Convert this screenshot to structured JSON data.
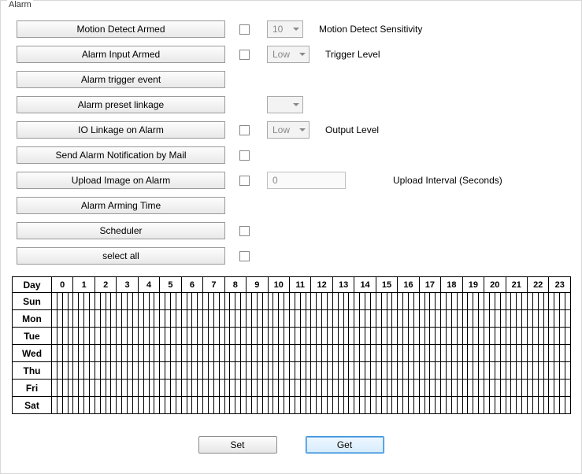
{
  "group_title": "Alarm",
  "rows": {
    "motion_detect_armed": "Motion Detect Armed",
    "alarm_input_armed": "Alarm Input Armed",
    "alarm_trigger_event": "Alarm trigger event",
    "alarm_preset_linkage": "Alarm preset linkage",
    "io_linkage_on_alarm": "IO Linkage on Alarm",
    "send_alarm_mail": "Send Alarm Notification by Mail",
    "upload_image_on_alarm": "Upload Image on Alarm",
    "alarm_arming_time": "Alarm Arming Time",
    "scheduler": "Scheduler",
    "select_all": "select all"
  },
  "selects": {
    "motion_sensitivity": "10",
    "trigger_level": "Low",
    "preset_linkage": "",
    "output_level": "Low"
  },
  "labels": {
    "motion_sensitivity": "Motion Detect Sensitivity",
    "trigger_level": "Trigger Level",
    "output_level": "Output Level",
    "upload_interval": "Upload Interval (Seconds)"
  },
  "inputs": {
    "upload_interval_value": "0"
  },
  "schedule": {
    "day_header": "Day",
    "hours": [
      "0",
      "1",
      "2",
      "3",
      "4",
      "5",
      "6",
      "7",
      "8",
      "9",
      "10",
      "11",
      "12",
      "13",
      "14",
      "15",
      "16",
      "17",
      "18",
      "19",
      "20",
      "21",
      "22",
      "23"
    ],
    "days": [
      "Sun",
      "Mon",
      "Tue",
      "Wed",
      "Thu",
      "Fri",
      "Sat"
    ]
  },
  "buttons": {
    "set": "Set",
    "get": "Get"
  }
}
